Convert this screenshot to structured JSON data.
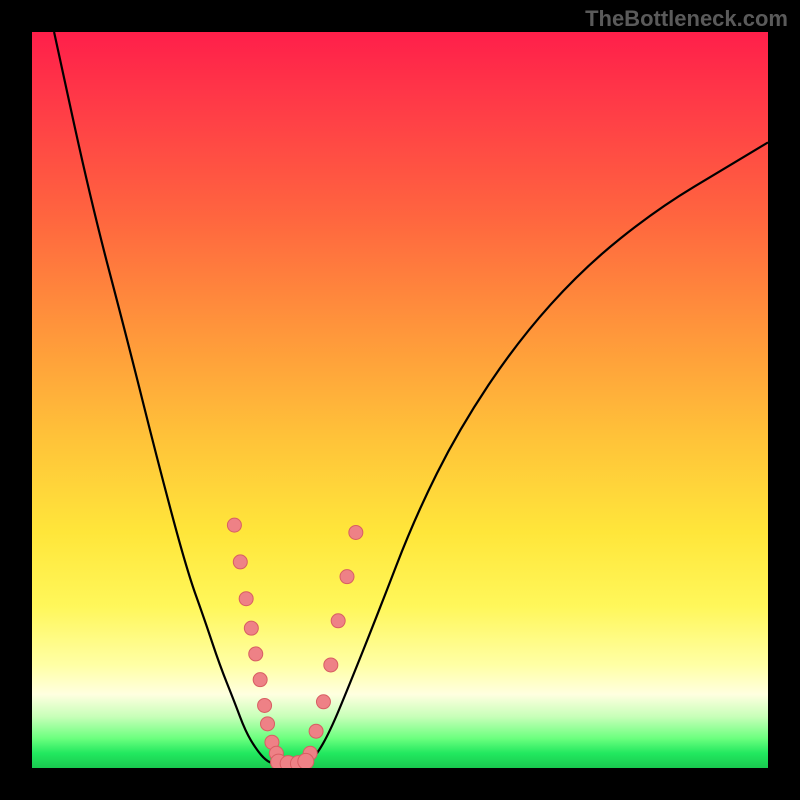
{
  "watermark": "TheBottleneck.com",
  "chart_data": {
    "type": "line",
    "title": "",
    "xlabel": "",
    "ylabel": "",
    "xlim": [
      0,
      100
    ],
    "ylim": [
      0,
      100
    ],
    "series": [
      {
        "name": "left-descending-curve",
        "x": [
          3,
          8,
          13,
          17,
          21,
          23.5,
          25.5,
          27.5,
          29,
          30.5,
          31.8,
          33
        ],
        "y": [
          100,
          77,
          58,
          42,
          27,
          20,
          14,
          9,
          5,
          2.5,
          1,
          0.5
        ]
      },
      {
        "name": "right-ascending-curve",
        "x": [
          37,
          38.5,
          40.5,
          43,
          47,
          52,
          58,
          66,
          75,
          85,
          95,
          100
        ],
        "y": [
          0.5,
          1.5,
          5,
          11,
          21,
          34,
          46,
          58,
          68,
          76,
          82,
          85
        ]
      }
    ],
    "markers_left": {
      "name": "left-markers",
      "x": [
        27.5,
        28.3,
        29.1,
        29.8,
        30.4,
        31.0,
        31.6,
        32.0,
        32.6,
        33.2
      ],
      "y": [
        33,
        28,
        23,
        19,
        15.5,
        12,
        8.5,
        6,
        3.5,
        2
      ]
    },
    "markers_right": {
      "name": "right-markers",
      "x": [
        37.8,
        38.6,
        39.6,
        40.6,
        41.6,
        42.8,
        44.0
      ],
      "y": [
        2,
        5,
        9,
        14,
        20,
        26,
        32
      ]
    },
    "valley_floor": {
      "name": "valley-floor-markers",
      "x": [
        33.5,
        34.8,
        36.2,
        37.2
      ],
      "y": [
        0.8,
        0.6,
        0.6,
        0.9
      ]
    }
  },
  "colors": {
    "curve": "#000000",
    "marker_fill": "#ee8186",
    "marker_stroke": "#d85e63"
  }
}
